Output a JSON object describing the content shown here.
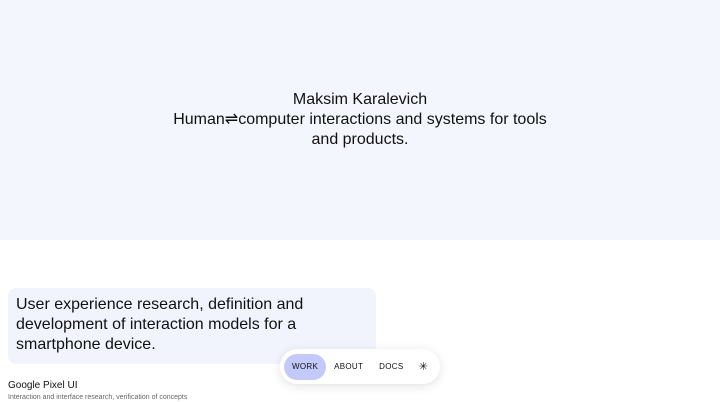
{
  "hero": {
    "name": "Maksim Karalevich",
    "tagline": "Human⇌computer interactions and systems for tools and products."
  },
  "card": {
    "text": "User experience research, definition and development of interaction models for a smartphone device."
  },
  "project": {
    "title": "Google Pixel UI",
    "subtitle": "Interaction and interface research, verification of concepts"
  },
  "nav": {
    "items": [
      {
        "label": "WORK",
        "active": true
      },
      {
        "label": "ABOUT",
        "active": false
      },
      {
        "label": "DOCS",
        "active": false
      }
    ],
    "theme_icon": "✳"
  },
  "colors": {
    "hero_background": "#f4f6fd",
    "card_background": "#f1f4fd",
    "nav_active": "#c3c9f8"
  }
}
